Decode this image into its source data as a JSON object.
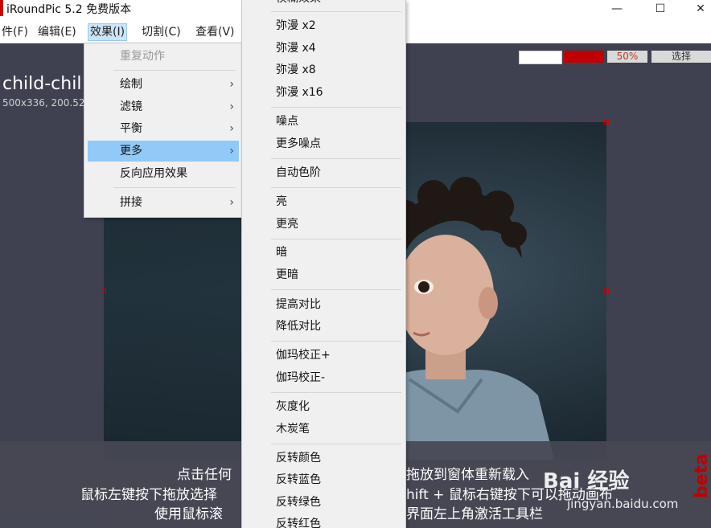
{
  "window": {
    "title": "iRoundPic 5.2 免费版本",
    "minimize_glyph": "—",
    "maximize_glyph": "☐",
    "close_glyph": "✕"
  },
  "menubar": {
    "items": [
      "件(F)",
      "编辑(E)",
      "效果(I)",
      "切割(C)",
      "查看(V)"
    ]
  },
  "toolbar": {
    "zoom": "50%",
    "select_label": "选择",
    "colors": {
      "white_swatch": "#ffffff",
      "red_swatch": "#c00000"
    }
  },
  "image": {
    "name": "child-chil",
    "meta": "500x336, 200.52"
  },
  "effects_menu": {
    "items": [
      {
        "label": "重复动作",
        "disabled": true,
        "submenu": false
      },
      {
        "label": "绘制",
        "disabled": false,
        "submenu": true
      },
      {
        "label": "滤镜",
        "disabled": false,
        "submenu": true
      },
      {
        "label": "平衡",
        "disabled": false,
        "submenu": true
      },
      {
        "label": "更多",
        "disabled": false,
        "submenu": true
      },
      {
        "label": "反向应用效果",
        "disabled": false,
        "submenu": false
      },
      {
        "label": "拼接",
        "disabled": false,
        "submenu": true
      }
    ],
    "submenu_arrow": "›"
  },
  "more_submenu": {
    "top_partial": "模糊效果",
    "items": [
      "弥漫 x2",
      "弥漫 x4",
      "弥漫 x8",
      "弥漫 x16",
      "噪点",
      "更多噪点",
      "自动色阶",
      "亮",
      "更亮",
      "暗",
      "更暗",
      "提高对比",
      "降低对比",
      "伽玛校正+",
      "伽玛校正-",
      "灰度化",
      "木炭笔",
      "反转颜色",
      "反转蓝色",
      "反转绿色",
      "反转红色"
    ]
  },
  "hints": {
    "line1_left": "点击任何",
    "line1_right": "拖放到窗体重新载入",
    "line2_left": "鼠标左键按下拖放选择",
    "line2_right": "hift + 鼠标右键按下可以拖动画布",
    "line3_left": "使用鼠标滚",
    "line3_right": "界面左上角激活工具栏"
  },
  "badge": {
    "beta": "beta"
  },
  "watermark": {
    "brand": "Bai 经验",
    "url": "jingyan.baidu.com"
  }
}
